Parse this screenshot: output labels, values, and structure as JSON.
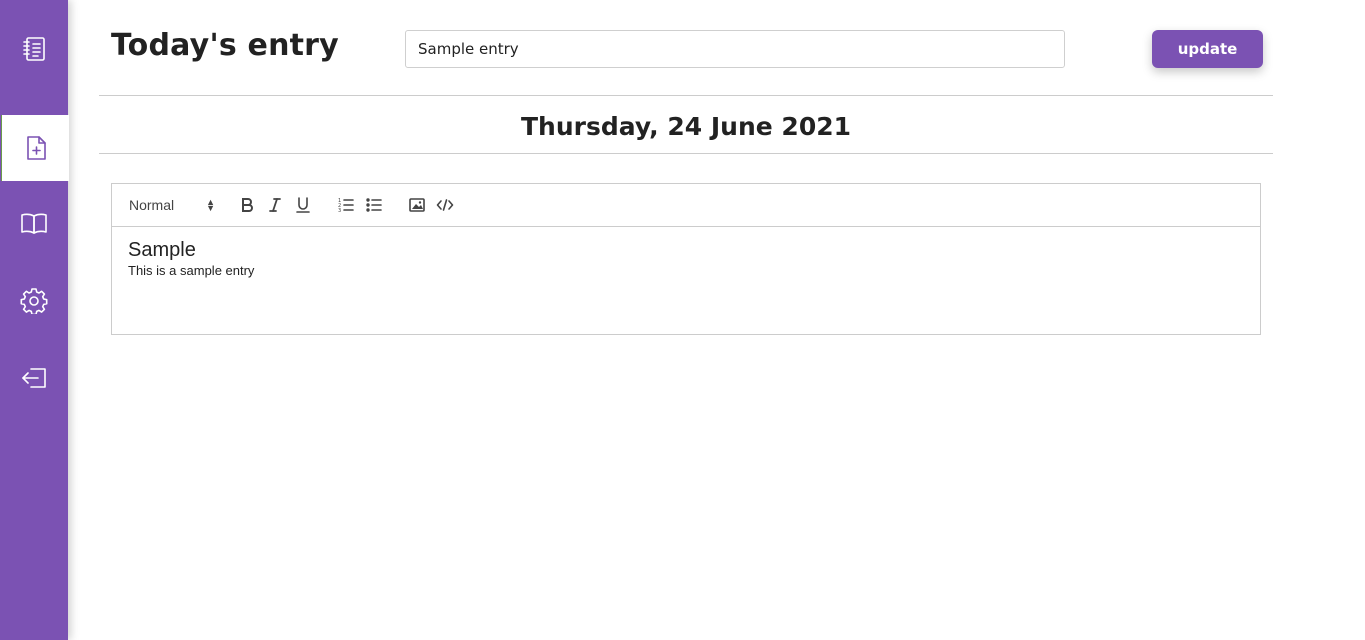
{
  "sidebar": {
    "items": [
      {
        "icon": "journal-list-icon",
        "active": false
      },
      {
        "icon": "new-file-icon",
        "active": true
      },
      {
        "icon": "open-book-icon",
        "active": false
      },
      {
        "icon": "gear-icon",
        "active": false
      },
      {
        "icon": "sign-out-icon",
        "active": false
      }
    ],
    "accent": "#7b52b3"
  },
  "header": {
    "title": "Today's entry",
    "entry_title_value": "Sample entry",
    "update_label": "update"
  },
  "date": "Thursday, 24 June 2021",
  "editor": {
    "toolbar": {
      "format_value": "Normal",
      "tools": [
        "bold-icon",
        "italic-icon",
        "underline-icon",
        "ordered-list-icon",
        "bullet-list-icon",
        "image-icon",
        "code-icon"
      ]
    },
    "heading": "Sample",
    "body": "This is a sample entry"
  }
}
